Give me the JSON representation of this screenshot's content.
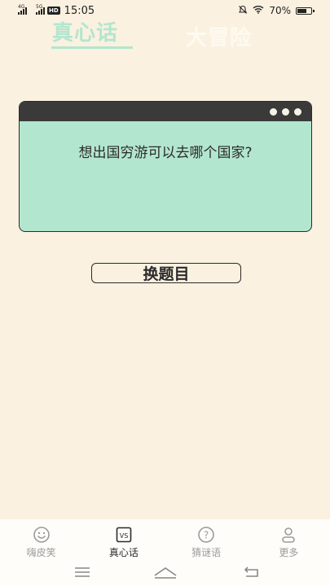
{
  "status_bar": {
    "net1": "4G",
    "net2": "5G",
    "hd": "HD",
    "time": "15:05",
    "battery": "70%",
    "battery_level": 0.7
  },
  "top_tabs": {
    "truth_label": "真心话",
    "dare_label": "大冒险"
  },
  "card": {
    "question": "想出国穷游可以去哪个国家?"
  },
  "actions": {
    "change_label": "换题目"
  },
  "bottom_nav": {
    "items": [
      {
        "label": "嗨皮笑",
        "icon": "smiley-face-icon"
      },
      {
        "label": "真心话",
        "icon": "vs-icon"
      },
      {
        "label": "猜谜语",
        "icon": "question-circle-icon"
      },
      {
        "label": "更多",
        "icon": "person-icon"
      }
    ],
    "vs_text": "VS",
    "q_text": "?"
  },
  "colors": {
    "background": "#faf1e0",
    "accent_mint": "#b3e6cf",
    "dark": "#2b2b2b"
  }
}
